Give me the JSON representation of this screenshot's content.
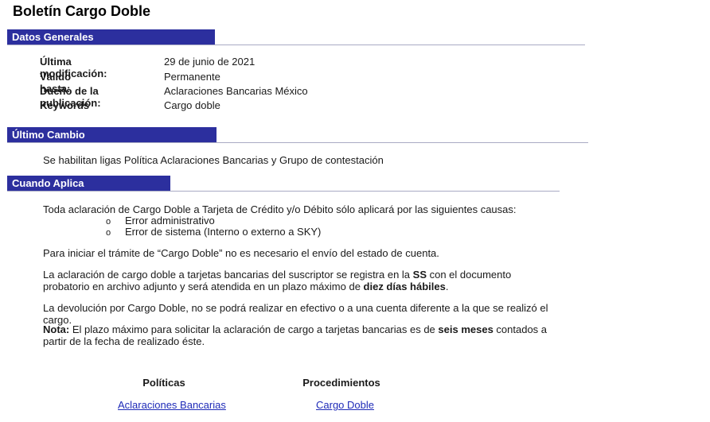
{
  "title": "Boletín Cargo Doble",
  "colors": {
    "section_bar": "#2c2f9e",
    "link": "#1f2bb8"
  },
  "datos_generales": {
    "header": "Datos Generales",
    "rows": [
      {
        "label": "Última modificación:",
        "value": "29 de junio de 2021"
      },
      {
        "label": "Válido hasta:",
        "value": "Permanente"
      },
      {
        "label": "Dueño de la publicación:",
        "value": "Aclaraciones Bancarias México"
      },
      {
        "label": "Keywords",
        "value": "Cargo doble"
      }
    ]
  },
  "ultimo_cambio": {
    "header": "Último Cambio",
    "text": "Se habilitan ligas Política Aclaraciones Bancarias y Grupo de contestación"
  },
  "cuando_aplica": {
    "header": "Cuando Aplica",
    "intro": "Toda aclaración de Cargo Doble a Tarjeta de Crédito y/o Débito sólo aplicará por las siguientes causas:",
    "bullet_mark": "o",
    "bullets": [
      "Error administrativo",
      "Error de sistema (Interno o externo a SKY)"
    ],
    "p1": "Para iniciar el trámite de “Cargo Doble” no es necesario el envío del estado de cuenta.",
    "p2_a": "La aclaración de cargo doble a tarjetas bancarias del suscriptor se registra en la ",
    "p2_b": "SS",
    "p2_c": " con el documento probatorio en archivo adjunto y será atendida en un plazo máximo de ",
    "p2_d": "diez días hábiles",
    "p2_e": ".",
    "p3": "La devolución por Cargo Doble, no se podrá realizar en efectivo o a una cuenta diferente a la que se realizó el cargo.",
    "p4_a": "Nota:",
    "p4_b": " El plazo máximo para solicitar la aclaración de cargo a tarjetas bancarias es de ",
    "p4_c": "seis meses",
    "p4_d": " contados a partir de la fecha de realizado éste."
  },
  "links": {
    "politicas_header": "Políticas",
    "procedimientos_header": "Procedimientos",
    "politicas_link": "Aclaraciones Bancarias",
    "procedimientos_link": "Cargo Doble"
  }
}
